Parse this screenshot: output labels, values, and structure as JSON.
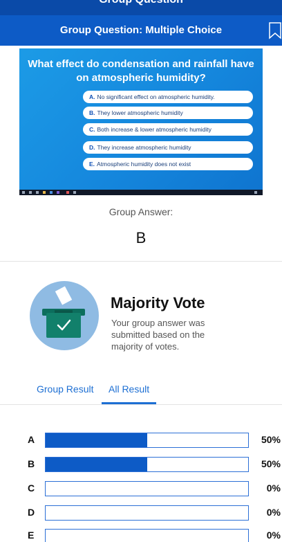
{
  "top_strip": {
    "text": "Group Question"
  },
  "header": {
    "title": "Group Question: Multiple Choice",
    "bookmark_icon": "bookmark-icon"
  },
  "slide": {
    "question": "What effect do condensation and rainfall have on atmospheric humidity?",
    "options": [
      {
        "letter": "A.",
        "text": "No significant effect on atmospheric humidity."
      },
      {
        "letter": "B.",
        "text": "They lower atmospheric humidity"
      },
      {
        "letter": "C.",
        "text": "Both increase & lower atmospheric humidity"
      },
      {
        "letter": "D.",
        "text": "They increase atmospheric humidity"
      },
      {
        "letter": "E.",
        "text": "Atmospheric humidity does not exist"
      }
    ]
  },
  "answer": {
    "label": "Group Answer:",
    "value": "B"
  },
  "majority": {
    "title": "Majority Vote",
    "description": "Your group answer was submitted based on the majority of votes.",
    "icon": "ballot-box-icon"
  },
  "tabs": [
    {
      "label": "Group Result",
      "active": false
    },
    {
      "label": "All Result",
      "active": true
    }
  ],
  "results": [
    {
      "letter": "A",
      "percent": 50,
      "label": "50%"
    },
    {
      "letter": "B",
      "percent": 50,
      "label": "50%"
    },
    {
      "letter": "C",
      "percent": 0,
      "label": "0%"
    },
    {
      "letter": "D",
      "percent": 0,
      "label": "0%"
    },
    {
      "letter": "E",
      "percent": 0,
      "label": "0%"
    }
  ],
  "colors": {
    "header": "#0d5bc6",
    "bar_fill": "#0d5bc6",
    "accent": "#1d6fd3",
    "circle": "#8fbbe3",
    "ballot_box": "#0e7d6a"
  }
}
